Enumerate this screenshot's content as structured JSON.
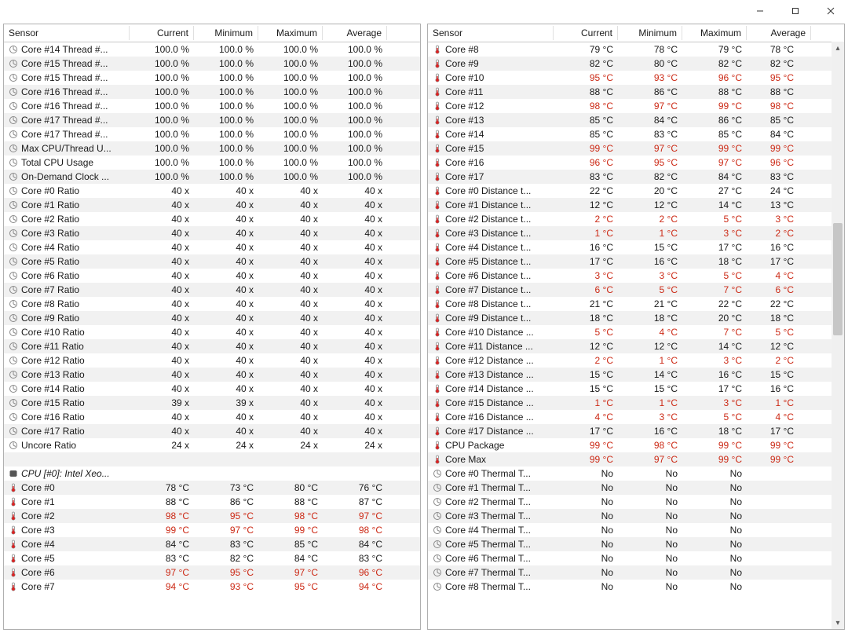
{
  "window": {
    "title": ""
  },
  "columns": {
    "sensor": "Sensor",
    "current": "Current",
    "minimum": "Minimum",
    "maximum": "Maximum",
    "average": "Average"
  },
  "left_rows": [
    {
      "icon": "load",
      "label": "Core #14 Thread #...",
      "cur": "100.0 %",
      "min": "100.0 %",
      "max": "100.0 %",
      "avg": "100.0 %"
    },
    {
      "icon": "load",
      "label": "Core #15 Thread #...",
      "cur": "100.0 %",
      "min": "100.0 %",
      "max": "100.0 %",
      "avg": "100.0 %"
    },
    {
      "icon": "load",
      "label": "Core #15 Thread #...",
      "cur": "100.0 %",
      "min": "100.0 %",
      "max": "100.0 %",
      "avg": "100.0 %"
    },
    {
      "icon": "load",
      "label": "Core #16 Thread #...",
      "cur": "100.0 %",
      "min": "100.0 %",
      "max": "100.0 %",
      "avg": "100.0 %"
    },
    {
      "icon": "load",
      "label": "Core #16 Thread #...",
      "cur": "100.0 %",
      "min": "100.0 %",
      "max": "100.0 %",
      "avg": "100.0 %"
    },
    {
      "icon": "load",
      "label": "Core #17 Thread #...",
      "cur": "100.0 %",
      "min": "100.0 %",
      "max": "100.0 %",
      "avg": "100.0 %"
    },
    {
      "icon": "load",
      "label": "Core #17 Thread #...",
      "cur": "100.0 %",
      "min": "100.0 %",
      "max": "100.0 %",
      "avg": "100.0 %"
    },
    {
      "icon": "load",
      "label": "Max CPU/Thread U...",
      "cur": "100.0 %",
      "min": "100.0 %",
      "max": "100.0 %",
      "avg": "100.0 %"
    },
    {
      "icon": "load",
      "label": "Total CPU Usage",
      "cur": "100.0 %",
      "min": "100.0 %",
      "max": "100.0 %",
      "avg": "100.0 %"
    },
    {
      "icon": "load",
      "label": "On-Demand Clock ...",
      "cur": "100.0 %",
      "min": "100.0 %",
      "max": "100.0 %",
      "avg": "100.0 %"
    },
    {
      "icon": "load",
      "label": "Core #0 Ratio",
      "cur": "40 x",
      "min": "40 x",
      "max": "40 x",
      "avg": "40 x"
    },
    {
      "icon": "load",
      "label": "Core #1 Ratio",
      "cur": "40 x",
      "min": "40 x",
      "max": "40 x",
      "avg": "40 x"
    },
    {
      "icon": "load",
      "label": "Core #2 Ratio",
      "cur": "40 x",
      "min": "40 x",
      "max": "40 x",
      "avg": "40 x"
    },
    {
      "icon": "load",
      "label": "Core #3 Ratio",
      "cur": "40 x",
      "min": "40 x",
      "max": "40 x",
      "avg": "40 x"
    },
    {
      "icon": "load",
      "label": "Core #4 Ratio",
      "cur": "40 x",
      "min": "40 x",
      "max": "40 x",
      "avg": "40 x"
    },
    {
      "icon": "load",
      "label": "Core #5 Ratio",
      "cur": "40 x",
      "min": "40 x",
      "max": "40 x",
      "avg": "40 x"
    },
    {
      "icon": "load",
      "label": "Core #6 Ratio",
      "cur": "40 x",
      "min": "40 x",
      "max": "40 x",
      "avg": "40 x"
    },
    {
      "icon": "load",
      "label": "Core #7 Ratio",
      "cur": "40 x",
      "min": "40 x",
      "max": "40 x",
      "avg": "40 x"
    },
    {
      "icon": "load",
      "label": "Core #8 Ratio",
      "cur": "40 x",
      "min": "40 x",
      "max": "40 x",
      "avg": "40 x"
    },
    {
      "icon": "load",
      "label": "Core #9 Ratio",
      "cur": "40 x",
      "min": "40 x",
      "max": "40 x",
      "avg": "40 x"
    },
    {
      "icon": "load",
      "label": "Core #10 Ratio",
      "cur": "40 x",
      "min": "40 x",
      "max": "40 x",
      "avg": "40 x"
    },
    {
      "icon": "load",
      "label": "Core #11 Ratio",
      "cur": "40 x",
      "min": "40 x",
      "max": "40 x",
      "avg": "40 x"
    },
    {
      "icon": "load",
      "label": "Core #12 Ratio",
      "cur": "40 x",
      "min": "40 x",
      "max": "40 x",
      "avg": "40 x"
    },
    {
      "icon": "load",
      "label": "Core #13 Ratio",
      "cur": "40 x",
      "min": "40 x",
      "max": "40 x",
      "avg": "40 x"
    },
    {
      "icon": "load",
      "label": "Core #14 Ratio",
      "cur": "40 x",
      "min": "40 x",
      "max": "40 x",
      "avg": "40 x"
    },
    {
      "icon": "load",
      "label": "Core #15 Ratio",
      "cur": "39 x",
      "min": "39 x",
      "max": "40 x",
      "avg": "40 x"
    },
    {
      "icon": "load",
      "label": "Core #16 Ratio",
      "cur": "40 x",
      "min": "40 x",
      "max": "40 x",
      "avg": "40 x"
    },
    {
      "icon": "load",
      "label": "Core #17 Ratio",
      "cur": "40 x",
      "min": "40 x",
      "max": "40 x",
      "avg": "40 x"
    },
    {
      "icon": "load",
      "label": "Uncore Ratio",
      "cur": "24 x",
      "min": "24 x",
      "max": "24 x",
      "avg": "24 x"
    },
    {
      "icon": "blank",
      "label": "",
      "cur": "",
      "min": "",
      "max": "",
      "avg": ""
    },
    {
      "icon": "chip",
      "label": "CPU [#0]: Intel Xeo...",
      "cur": "",
      "min": "",
      "max": "",
      "avg": "",
      "group": true
    },
    {
      "icon": "temp",
      "label": "Core #0",
      "cur": "78 °C",
      "min": "73 °C",
      "max": "80 °C",
      "avg": "76 °C"
    },
    {
      "icon": "temp",
      "label": "Core #1",
      "cur": "88 °C",
      "min": "86 °C",
      "max": "88 °C",
      "avg": "87 °C"
    },
    {
      "icon": "temp",
      "label": "Core #2",
      "cur": "98 °C",
      "min": "95 °C",
      "max": "98 °C",
      "avg": "97 °C",
      "hot": true
    },
    {
      "icon": "temp",
      "label": "Core #3",
      "cur": "99 °C",
      "min": "97 °C",
      "max": "99 °C",
      "avg": "98 °C",
      "hot": true
    },
    {
      "icon": "temp",
      "label": "Core #4",
      "cur": "84 °C",
      "min": "83 °C",
      "max": "85 °C",
      "avg": "84 °C"
    },
    {
      "icon": "temp",
      "label": "Core #5",
      "cur": "83 °C",
      "min": "82 °C",
      "max": "84 °C",
      "avg": "83 °C"
    },
    {
      "icon": "temp",
      "label": "Core #6",
      "cur": "97 °C",
      "min": "95 °C",
      "max": "97 °C",
      "avg": "96 °C",
      "hot": true
    },
    {
      "icon": "temp",
      "label": "Core #7",
      "cur": "94 °C",
      "min": "93 °C",
      "max": "95 °C",
      "avg": "94 °C",
      "hot": true
    }
  ],
  "right_rows": [
    {
      "icon": "temp",
      "label": "Core #8",
      "cur": "79 °C",
      "min": "78 °C",
      "max": "79 °C",
      "avg": "78 °C"
    },
    {
      "icon": "temp",
      "label": "Core #9",
      "cur": "82 °C",
      "min": "80 °C",
      "max": "82 °C",
      "avg": "82 °C"
    },
    {
      "icon": "temp",
      "label": "Core #10",
      "cur": "95 °C",
      "min": "93 °C",
      "max": "96 °C",
      "avg": "95 °C",
      "hot": true
    },
    {
      "icon": "temp",
      "label": "Core #11",
      "cur": "88 °C",
      "min": "86 °C",
      "max": "88 °C",
      "avg": "88 °C"
    },
    {
      "icon": "temp",
      "label": "Core #12",
      "cur": "98 °C",
      "min": "97 °C",
      "max": "99 °C",
      "avg": "98 °C",
      "hot": true
    },
    {
      "icon": "temp",
      "label": "Core #13",
      "cur": "85 °C",
      "min": "84 °C",
      "max": "86 °C",
      "avg": "85 °C"
    },
    {
      "icon": "temp",
      "label": "Core #14",
      "cur": "85 °C",
      "min": "83 °C",
      "max": "85 °C",
      "avg": "84 °C"
    },
    {
      "icon": "temp",
      "label": "Core #15",
      "cur": "99 °C",
      "min": "97 °C",
      "max": "99 °C",
      "avg": "99 °C",
      "hot": true
    },
    {
      "icon": "temp",
      "label": "Core #16",
      "cur": "96 °C",
      "min": "95 °C",
      "max": "97 °C",
      "avg": "96 °C",
      "hot": true
    },
    {
      "icon": "temp",
      "label": "Core #17",
      "cur": "83 °C",
      "min": "82 °C",
      "max": "84 °C",
      "avg": "83 °C"
    },
    {
      "icon": "temp",
      "label": "Core #0 Distance t...",
      "cur": "22 °C",
      "min": "20 °C",
      "max": "27 °C",
      "avg": "24 °C"
    },
    {
      "icon": "temp",
      "label": "Core #1 Distance t...",
      "cur": "12 °C",
      "min": "12 °C",
      "max": "14 °C",
      "avg": "13 °C"
    },
    {
      "icon": "temp",
      "label": "Core #2 Distance t...",
      "cur": "2 °C",
      "min": "2 °C",
      "max": "5 °C",
      "avg": "3 °C",
      "hot": true
    },
    {
      "icon": "temp",
      "label": "Core #3 Distance t...",
      "cur": "1 °C",
      "min": "1 °C",
      "max": "3 °C",
      "avg": "2 °C",
      "hot": true
    },
    {
      "icon": "temp",
      "label": "Core #4 Distance t...",
      "cur": "16 °C",
      "min": "15 °C",
      "max": "17 °C",
      "avg": "16 °C"
    },
    {
      "icon": "temp",
      "label": "Core #5 Distance t...",
      "cur": "17 °C",
      "min": "16 °C",
      "max": "18 °C",
      "avg": "17 °C"
    },
    {
      "icon": "temp",
      "label": "Core #6 Distance t...",
      "cur": "3 °C",
      "min": "3 °C",
      "max": "5 °C",
      "avg": "4 °C",
      "hot": true
    },
    {
      "icon": "temp",
      "label": "Core #7 Distance t...",
      "cur": "6 °C",
      "min": "5 °C",
      "max": "7 °C",
      "avg": "6 °C",
      "hot": true
    },
    {
      "icon": "temp",
      "label": "Core #8 Distance t...",
      "cur": "21 °C",
      "min": "21 °C",
      "max": "22 °C",
      "avg": "22 °C"
    },
    {
      "icon": "temp",
      "label": "Core #9 Distance t...",
      "cur": "18 °C",
      "min": "18 °C",
      "max": "20 °C",
      "avg": "18 °C"
    },
    {
      "icon": "temp",
      "label": "Core #10 Distance ...",
      "cur": "5 °C",
      "min": "4 °C",
      "max": "7 °C",
      "avg": "5 °C",
      "hot": true
    },
    {
      "icon": "temp",
      "label": "Core #11 Distance ...",
      "cur": "12 °C",
      "min": "12 °C",
      "max": "14 °C",
      "avg": "12 °C"
    },
    {
      "icon": "temp",
      "label": "Core #12 Distance ...",
      "cur": "2 °C",
      "min": "1 °C",
      "max": "3 °C",
      "avg": "2 °C",
      "hot": true
    },
    {
      "icon": "temp",
      "label": "Core #13 Distance ...",
      "cur": "15 °C",
      "min": "14 °C",
      "max": "16 °C",
      "avg": "15 °C"
    },
    {
      "icon": "temp",
      "label": "Core #14 Distance ...",
      "cur": "15 °C",
      "min": "15 °C",
      "max": "17 °C",
      "avg": "16 °C"
    },
    {
      "icon": "temp",
      "label": "Core #15 Distance ...",
      "cur": "1 °C",
      "min": "1 °C",
      "max": "3 °C",
      "avg": "1 °C",
      "hot": true
    },
    {
      "icon": "temp",
      "label": "Core #16 Distance ...",
      "cur": "4 °C",
      "min": "3 °C",
      "max": "5 °C",
      "avg": "4 °C",
      "hot": true
    },
    {
      "icon": "temp",
      "label": "Core #17 Distance ...",
      "cur": "17 °C",
      "min": "16 °C",
      "max": "18 °C",
      "avg": "17 °C"
    },
    {
      "icon": "temp",
      "label": "CPU Package",
      "cur": "99 °C",
      "min": "98 °C",
      "max": "99 °C",
      "avg": "99 °C",
      "hot": true
    },
    {
      "icon": "temp",
      "label": "Core Max",
      "cur": "99 °C",
      "min": "97 °C",
      "max": "99 °C",
      "avg": "99 °C",
      "hot": true
    },
    {
      "icon": "load",
      "label": "Core #0 Thermal T...",
      "cur": "No",
      "min": "No",
      "max": "No",
      "avg": ""
    },
    {
      "icon": "load",
      "label": "Core #1 Thermal T...",
      "cur": "No",
      "min": "No",
      "max": "No",
      "avg": ""
    },
    {
      "icon": "load",
      "label": "Core #2 Thermal T...",
      "cur": "No",
      "min": "No",
      "max": "No",
      "avg": ""
    },
    {
      "icon": "load",
      "label": "Core #3 Thermal T...",
      "cur": "No",
      "min": "No",
      "max": "No",
      "avg": ""
    },
    {
      "icon": "load",
      "label": "Core #4 Thermal T...",
      "cur": "No",
      "min": "No",
      "max": "No",
      "avg": ""
    },
    {
      "icon": "load",
      "label": "Core #5 Thermal T...",
      "cur": "No",
      "min": "No",
      "max": "No",
      "avg": ""
    },
    {
      "icon": "load",
      "label": "Core #6 Thermal T...",
      "cur": "No",
      "min": "No",
      "max": "No",
      "avg": ""
    },
    {
      "icon": "load",
      "label": "Core #7 Thermal T...",
      "cur": "No",
      "min": "No",
      "max": "No",
      "avg": ""
    },
    {
      "icon": "load",
      "label": "Core #8 Thermal T...",
      "cur": "No",
      "min": "No",
      "max": "No",
      "avg": ""
    }
  ],
  "scrollbar": {
    "thumb_top_pct": 30,
    "thumb_height_pct": 20
  }
}
